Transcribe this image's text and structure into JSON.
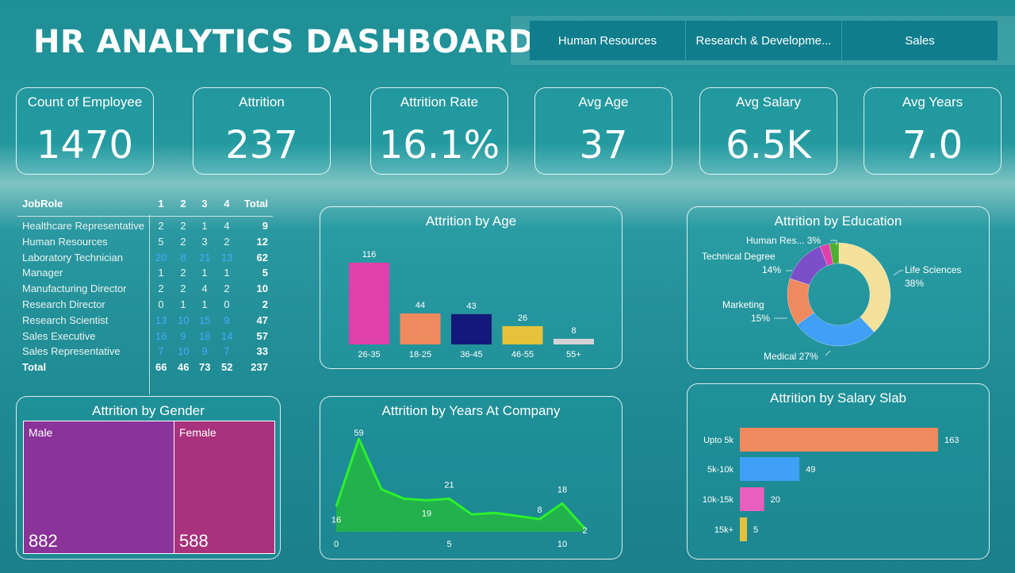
{
  "header": {
    "title": "HR ANALYTICS DASHBOARD"
  },
  "slicer": {
    "options": [
      "Human Resources",
      "Research & Developme...",
      "Sales"
    ]
  },
  "kpis": [
    {
      "label": "Count of Employee",
      "value": "1470"
    },
    {
      "label": "Attrition",
      "value": "237"
    },
    {
      "label": "Attrition Rate",
      "value": "16.1%"
    },
    {
      "label": "Avg Age",
      "value": "37"
    },
    {
      "label": "Avg Salary",
      "value": "6.5K"
    },
    {
      "label": "Avg Years",
      "value": "7.0"
    }
  ],
  "matrix": {
    "headers": [
      "JobRole",
      "1",
      "2",
      "3",
      "4",
      "Total"
    ],
    "rows": [
      {
        "role": "Healthcare Representative",
        "v": [
          "2",
          "2",
          "1",
          "4"
        ],
        "total": "9"
      },
      {
        "role": "Human Resources",
        "v": [
          "5",
          "2",
          "3",
          "2"
        ],
        "total": "12"
      },
      {
        "role": "Laboratory Technician",
        "v": [
          "20",
          "8",
          "21",
          "13"
        ],
        "total": "62"
      },
      {
        "role": "Manager",
        "v": [
          "1",
          "2",
          "1",
          "1"
        ],
        "total": "5"
      },
      {
        "role": "Manufacturing Director",
        "v": [
          "2",
          "2",
          "4",
          "2"
        ],
        "total": "10"
      },
      {
        "role": "Research Director",
        "v": [
          "0",
          "1",
          "1",
          "0"
        ],
        "total": "2"
      },
      {
        "role": "Research Scientist",
        "v": [
          "13",
          "10",
          "15",
          "9"
        ],
        "total": "47"
      },
      {
        "role": "Sales Executive",
        "v": [
          "16",
          "9",
          "18",
          "14"
        ],
        "total": "57"
      },
      {
        "role": "Sales Representative",
        "v": [
          "7",
          "10",
          "9",
          "7"
        ],
        "total": "33"
      }
    ],
    "total_row": {
      "role": "Total",
      "v": [
        "66",
        "46",
        "73",
        "52"
      ],
      "total": "237"
    },
    "highlight_color": "#49a9ff"
  },
  "panels": {
    "age": "Attrition by Age",
    "education": "Attrition by Education",
    "gender": "Attrition by Gender",
    "years": "Attrition by Years At Company",
    "salary": "Attrition by Salary Slab"
  },
  "chart_data": [
    {
      "id": "age",
      "type": "bar",
      "title": "Attrition by Age",
      "categories": [
        "26-35",
        "18-25",
        "36-45",
        "46-55",
        "55+"
      ],
      "values": [
        116,
        44,
        43,
        26,
        8
      ],
      "colors": [
        "#e040ab",
        "#ef8a5e",
        "#13197a",
        "#e5c23a",
        "#d4d4d4"
      ]
    },
    {
      "id": "education",
      "type": "pie",
      "title": "Attrition by Education",
      "labels": [
        "Life Sciences",
        "Medical",
        "Marketing",
        "Technical Degree",
        "Human Res...",
        ""
      ],
      "values": [
        38,
        27,
        15,
        14,
        3,
        3
      ],
      "pct_labels": [
        "38%",
        "27%",
        "15%",
        "14%",
        "3%",
        ""
      ],
      "colors": [
        "#f3e19c",
        "#3fa0f5",
        "#ef8a5e",
        "#7c4fc9",
        "#e040ab",
        "#4caf2f"
      ]
    },
    {
      "id": "gender",
      "type": "treemap",
      "title": "Attrition by Gender",
      "categories": [
        "Male",
        "Female"
      ],
      "values": [
        882,
        588
      ],
      "colors": [
        "#8a3399",
        "#a8327b"
      ]
    },
    {
      "id": "years",
      "type": "area",
      "title": "Attrition by Years At Company",
      "x": [
        0,
        1,
        2,
        3,
        4,
        5,
        6,
        7,
        8,
        9,
        10,
        11
      ],
      "values": [
        16,
        59,
        27,
        21,
        20,
        21,
        11,
        12,
        10,
        8,
        18,
        2
      ],
      "point_labels": {
        "0": "16",
        "1": "59",
        "4": "19",
        "5": "21",
        "9": "8",
        "10": "18",
        "11": "2"
      },
      "x_ticks": [
        "0",
        "5",
        "10"
      ],
      "color": "#22b14c",
      "line_color": "#2df02d"
    },
    {
      "id": "salary",
      "type": "bar",
      "orientation": "horizontal",
      "title": "Attrition by Salary Slab",
      "categories": [
        "Upto 5k",
        "5k-10k",
        "10k-15k",
        "15k+"
      ],
      "values": [
        163,
        49,
        20,
        5
      ],
      "colors": [
        "#ef8a5e",
        "#3fa0f5",
        "#e95fbd",
        "#e5c23a"
      ]
    }
  ]
}
